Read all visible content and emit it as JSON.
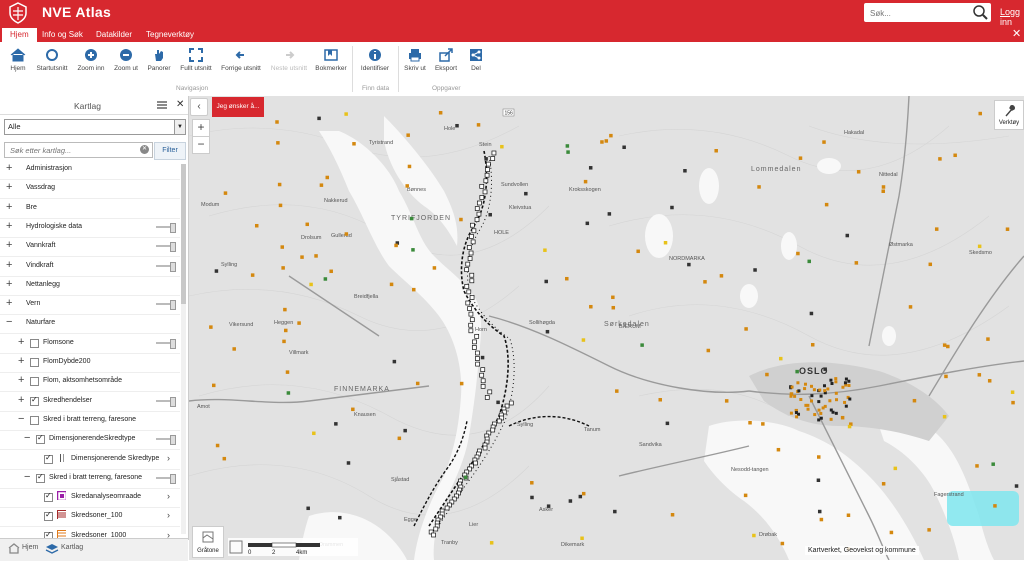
{
  "app": {
    "title": "NVE Atlas",
    "search_placeholder": "Søk...",
    "login": "Logg inn"
  },
  "tabs": [
    {
      "label": "Hjem",
      "active": true
    },
    {
      "label": "Info og Søk"
    },
    {
      "label": "Datakilder"
    },
    {
      "label": "Tegneverktøy"
    }
  ],
  "ribbon": {
    "buttons": [
      "Hjem",
      "Startutsnitt",
      "Zoom inn",
      "Zoom ut",
      "Panorer",
      "Fullt utsnitt",
      "Forrige utsnitt",
      "Neste utsnitt",
      "Bokmerker",
      "Identifiser",
      "Skriv ut",
      "Eksport",
      "Del"
    ],
    "groups": [
      "Navigasjon",
      "Finn data",
      "Oppgaver"
    ]
  },
  "panel": {
    "title": "Kartlag",
    "filter_value": "Alle",
    "search_placeholder": "Søk etter kartlag...",
    "filter_button": "Filter",
    "layers": [
      {
        "label": "Administrasjon",
        "level": 0,
        "expand": "+"
      },
      {
        "label": "Vassdrag",
        "level": 0,
        "expand": "+"
      },
      {
        "label": "Bre",
        "level": 0,
        "expand": "+"
      },
      {
        "label": "Hydrologiske data",
        "level": 0,
        "expand": "+",
        "slider": true
      },
      {
        "label": "Vannkraft",
        "level": 0,
        "expand": "+",
        "slider": true
      },
      {
        "label": "Vindkraft",
        "level": 0,
        "expand": "+",
        "slider": true
      },
      {
        "label": "Nettanlegg",
        "level": 0,
        "expand": "+"
      },
      {
        "label": "Vern",
        "level": 0,
        "expand": "+",
        "slider": true
      },
      {
        "label": "Naturfare",
        "level": 0,
        "expand": "−"
      },
      {
        "label": "Flomsone",
        "level": 1,
        "expand": "+",
        "checkbox": false,
        "slider": true
      },
      {
        "label": "FlomDybde200",
        "level": 1,
        "expand": "+",
        "checkbox": false
      },
      {
        "label": "Flom, aktsomhetsområde",
        "level": 1,
        "expand": "+",
        "checkbox": false
      },
      {
        "label": "Skredhendelser",
        "level": 1,
        "expand": "+",
        "checkbox": true,
        "slider": true
      },
      {
        "label": "Skred i bratt terreng, faresone",
        "level": 1,
        "expand": "−",
        "checkbox": false
      },
      {
        "label": "DimensjonerendeSkredtype",
        "level": 2,
        "expand": "−",
        "checkbox": true,
        "slider": true
      },
      {
        "label": "Dimensjonerende Skredtype",
        "level": 3,
        "checkbox": true,
        "legend": "dim",
        "chevron": true
      },
      {
        "label": "Skred i bratt terreng, faresone",
        "level": 2,
        "expand": "−",
        "checkbox": true,
        "slider": true
      },
      {
        "label": "Skredanalyseomraade",
        "level": 3,
        "checkbox": true,
        "legend": "purple",
        "chevron": true
      },
      {
        "label": "Skredsoner_100",
        "level": 3,
        "checkbox": true,
        "legend": "red",
        "chevron": true
      },
      {
        "label": "Skredsoner_1000",
        "level": 3,
        "checkbox": true,
        "legend": "orange",
        "chevron": true
      }
    ]
  },
  "bottom_tabs": [
    "Hjem",
    "Kartlag"
  ],
  "map": {
    "wish_button": "Jeg ønsker å...",
    "tools_button": "Verktøy",
    "basemap": "Gråtone",
    "attribution": "Kartverket, Geovekst og kommune",
    "scale_labels": [
      "0",
      "2",
      "4km"
    ],
    "place_names": [
      "Hole",
      "Tyristrand",
      "Bønnes",
      "Nakkerud",
      "TYRIFJORDEN",
      "Drolsum",
      "Gullerud",
      "Sylling",
      "Modum",
      "Vikersund",
      "Heggen",
      "Villmark",
      "Breidfjella",
      "FINNEMARKA",
      "Amot",
      "Knausen",
      "Sjåstad",
      "Egge",
      "Drammen",
      "Stein",
      "Sundvollen",
      "HOLE",
      "Kleivstua",
      "Sollihøgda",
      "Horn",
      "Kroksskogen",
      "Sylling",
      "Tanum",
      "Sandvika",
      "BÆRUM",
      "NORDMARKA",
      "Sørkedalen",
      "Lommedalen",
      "Asker",
      "Tranby",
      "Lier",
      "Dikemark",
      "Nesodd-tangen",
      "OSLO",
      "Østmarka",
      "Hakadal",
      "Nittedal",
      "Skedsmo",
      "Fagerstrand",
      "Drøbak"
    ],
    "road_badge": "156"
  }
}
